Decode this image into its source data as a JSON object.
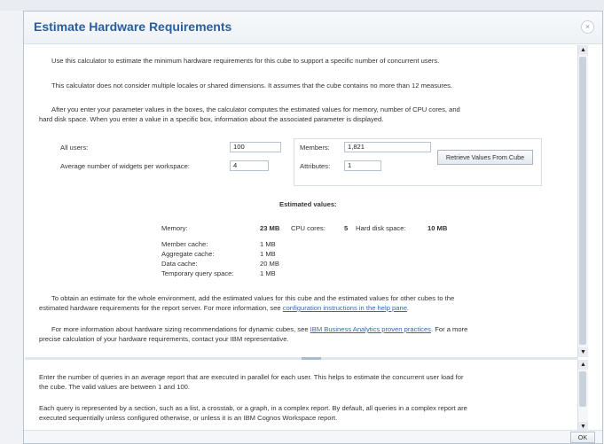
{
  "dialog": {
    "title": "Estimate Hardware Requirements",
    "close_icon": "×"
  },
  "intro": {
    "p1": "Use this calculator to estimate the minimum hardware requirements for this cube to support a specific number of concurrent users.",
    "p2": "This calculator does not consider multiple locales or shared dimensions. It assumes that the cube contains no more than 12 measures.",
    "p3_line1": "After you enter your parameter values in the boxes, the calculator computes the estimated values for memory, number of CPU cores, and",
    "p3_line2": "hard disk space. When you enter a value in a specific box, information about the associated parameter is displayed."
  },
  "form": {
    "all_users_label": "All users:",
    "all_users_value": "100",
    "widgets_label": "Average number of widgets per workspace:",
    "widgets_value": "4",
    "members_label": "Members:",
    "members_value": "1,821",
    "attributes_label": "Attributes:",
    "attributes_value": "1",
    "retrieve_button": "Retrieve Values From Cube"
  },
  "estimates": {
    "heading": "Estimated values:",
    "memory_label": "Memory:",
    "memory_value": "23 MB",
    "cpu_label": "CPU cores:",
    "cpu_value": "5",
    "disk_label": "Hard disk space:",
    "disk_value": "10 MB",
    "breakdown": [
      {
        "label": "Member cache:",
        "value": "1 MB"
      },
      {
        "label": "Aggregate cache:",
        "value": "1 MB"
      },
      {
        "label": "Data cache:",
        "value": "20 MB"
      },
      {
        "label": "Temporary query space:",
        "value": "1 MB"
      }
    ]
  },
  "notes": {
    "env_line1": "To obtain an estimate for the whole environment, add the estimated values for this cube and the estimated values for other cubes to the",
    "env_line2_prefix": "estimated hardware requirements for the report server. For more information, see ",
    "env_link": "configuration instructions in the help pane",
    "env_suffix": ".",
    "info_line1_prefix": "For more information about hardware sizing recommendations for dynamic cubes, see ",
    "info_link": "IBM Business Analytics proven practices",
    "info_line1_suffix": ". For a more",
    "info_line2": "precise calculation of your hardware requirements, contact your IBM representative."
  },
  "help": {
    "p1_line1": "Enter the number of queries in an average report that are executed in parallel for each user. This helps to estimate the concurrent user load for",
    "p1_line2": "the cube. The valid values are between 1 and 100.",
    "p2_line1": "Each query is represented by a section, such as a list, a crosstab, or a graph, in a complex report. By default, all queries in a complex report are",
    "p2_line2": "executed sequentially unless configured otherwise, or unless it is an IBM Cognos Workspace report."
  },
  "footer": {
    "ok_button": "OK"
  },
  "icons": {
    "scroll_up": "▲",
    "scroll_down": "▼"
  }
}
